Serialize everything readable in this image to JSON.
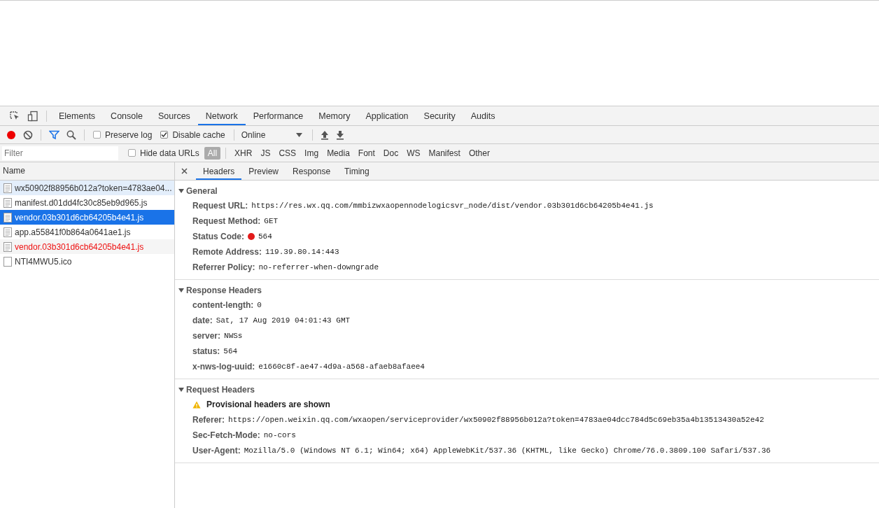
{
  "panel_tabs": [
    {
      "label": "Elements",
      "selected": false
    },
    {
      "label": "Console",
      "selected": false
    },
    {
      "label": "Sources",
      "selected": false
    },
    {
      "label": "Network",
      "selected": true
    },
    {
      "label": "Performance",
      "selected": false
    },
    {
      "label": "Memory",
      "selected": false
    },
    {
      "label": "Application",
      "selected": false
    },
    {
      "label": "Security",
      "selected": false
    },
    {
      "label": "Audits",
      "selected": false
    }
  ],
  "toolbar": {
    "recording": true,
    "filter_active": true,
    "preserve_log": {
      "label": "Preserve log",
      "checked": false
    },
    "disable_cache": {
      "label": "Disable cache",
      "checked": true
    },
    "throttling": "Online"
  },
  "filter_bar": {
    "placeholder": "Filter",
    "hide_data_urls": {
      "label": "Hide data URLs",
      "checked": false
    },
    "types": [
      {
        "label": "All",
        "selected": true
      },
      {
        "label": "XHR",
        "selected": false
      },
      {
        "label": "JS",
        "selected": false
      },
      {
        "label": "CSS",
        "selected": false
      },
      {
        "label": "Img",
        "selected": false
      },
      {
        "label": "Media",
        "selected": false
      },
      {
        "label": "Font",
        "selected": false
      },
      {
        "label": "Doc",
        "selected": false
      },
      {
        "label": "WS",
        "selected": false
      },
      {
        "label": "Manifest",
        "selected": false
      },
      {
        "label": "Other",
        "selected": false
      }
    ]
  },
  "requests": {
    "column": "Name",
    "rows": [
      {
        "name": "wx50902f88956b012a?token=4783ae04...",
        "kind": "document",
        "selected": false,
        "hovered": true,
        "error": false
      },
      {
        "name": "manifest.d01dd4fc30c85eb9d965.js",
        "kind": "document",
        "selected": false,
        "hovered": false,
        "error": false
      },
      {
        "name": "vendor.03b301d6cb64205b4e41.js",
        "kind": "document",
        "selected": true,
        "hovered": false,
        "error": false
      },
      {
        "name": "app.a55841f0b864a0641ae1.js",
        "kind": "document",
        "selected": false,
        "hovered": false,
        "error": false
      },
      {
        "name": "vendor.03b301d6cb64205b4e41.js",
        "kind": "document",
        "selected": false,
        "hovered": false,
        "error": true
      },
      {
        "name": "NTI4MWU5.ico",
        "kind": "image",
        "selected": false,
        "hovered": false,
        "error": false
      }
    ]
  },
  "detail_tabs": [
    {
      "label": "Headers",
      "selected": true
    },
    {
      "label": "Preview",
      "selected": false
    },
    {
      "label": "Response",
      "selected": false
    },
    {
      "label": "Timing",
      "selected": false
    }
  ],
  "sections": [
    {
      "title": "General",
      "expanded": true,
      "rows": [
        {
          "key": "Request URL:",
          "value": "https://res.wx.qq.com/mmbizwxaopennodelogicsvr_node/dist/vendor.03b301d6cb64205b4e41.js"
        },
        {
          "key": "Request Method:",
          "value": "GET"
        },
        {
          "key": "Status Code:",
          "value": "564",
          "error": true
        },
        {
          "key": "Remote Address:",
          "value": "119.39.80.14:443"
        },
        {
          "key": "Referrer Policy:",
          "value": "no-referrer-when-downgrade"
        }
      ]
    },
    {
      "title": "Response Headers",
      "expanded": true,
      "rows": [
        {
          "key": "content-length:",
          "value": "0"
        },
        {
          "key": "date:",
          "value": "Sat, 17 Aug 2019 04:01:43 GMT"
        },
        {
          "key": "server:",
          "value": "NWSs"
        },
        {
          "key": "status:",
          "value": "564"
        },
        {
          "key": "x-nws-log-uuid:",
          "value": "e1660c8f-ae47-4d9a-a568-afaeb8afaee4"
        }
      ]
    },
    {
      "title": "Request Headers",
      "expanded": true,
      "warning": "Provisional headers are shown",
      "rows": [
        {
          "key": "Referer:",
          "value": "https://open.weixin.qq.com/wxaopen/serviceprovider/wx50902f88956b012a?token=4783ae04dcc784d5c69eb35a4b13513430a52e42"
        },
        {
          "key": "Sec-Fetch-Mode:",
          "value": "no-cors"
        },
        {
          "key": "User-Agent:",
          "value": "Mozilla/5.0 (Windows NT 6.1; Win64; x64) AppleWebKit/537.36 (KHTML, like Gecko) Chrome/76.0.3809.100 Safari/537.36"
        }
      ]
    }
  ]
}
